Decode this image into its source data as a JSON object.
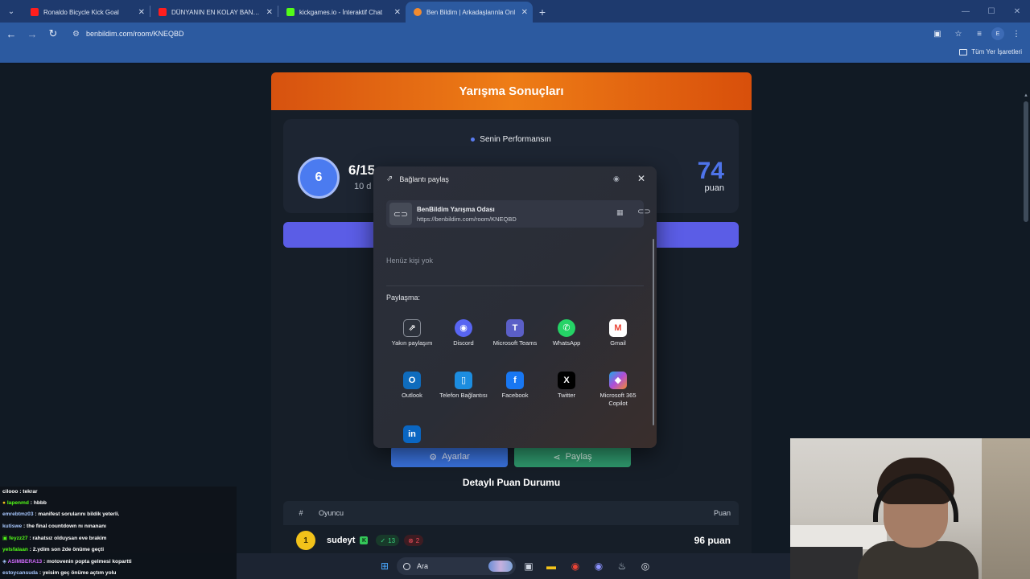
{
  "browser": {
    "tabs": [
      {
        "title": "Ronaldo Bicycle Kick Goal",
        "color": "#ff1e1e",
        "active": false
      },
      {
        "title": "DÜNYANIN EN KOLAY BANKA",
        "color": "#ff1e1e",
        "active": false
      },
      {
        "title": "kickgames.io - İnteraktif Chat",
        "color": "#53fc18",
        "active": false
      },
      {
        "title": "Ben Bildim | Arkadaşlarınla Onl",
        "color": "#f28b30",
        "active": true
      }
    ],
    "url": "benbildim.com/room/KNEQBD",
    "profile_initial": "E",
    "bookmarks_label": "Tüm Yer İşaretleri"
  },
  "results": {
    "header_title": "Yarışma Sonuçları",
    "perf_label": "Senin Performansın",
    "rank": "6",
    "score_fraction": "6/15",
    "score_sub": "10 d",
    "points": "74",
    "points_label": "puan",
    "settings_label": "Ayarlar",
    "share_label": "Paylaş",
    "detail_title": "Detaylı Puan Durumu",
    "table": {
      "col_num": "#",
      "col_player": "Oyuncu",
      "col_points": "Puan",
      "rows": [
        {
          "rank": "1",
          "name": "sudeyt",
          "correct": "13",
          "wrong": "2",
          "points": "96 puan"
        }
      ]
    }
  },
  "share_dialog": {
    "title": "Bağlantı paylaş",
    "link_title": "BenBildim Yarışma Odası",
    "link_url": "https://benbildim.com/room/KNEQBD",
    "no_people": "Henüz kişi yok",
    "share_with": "Paylaşma:",
    "apps": [
      {
        "label": "Yakın paylaşım",
        "icon": "nearby-share-icon",
        "color": "#2d323c"
      },
      {
        "label": "Discord",
        "icon": "discord-icon",
        "color": "#5865f2"
      },
      {
        "label": "Microsoft Teams",
        "icon": "teams-icon",
        "color": "#5b5fc7"
      },
      {
        "label": "WhatsApp",
        "icon": "whatsapp-icon",
        "color": "#25d366"
      },
      {
        "label": "Gmail",
        "icon": "gmail-icon",
        "color": "#ea4335"
      },
      {
        "label": "Outlook",
        "icon": "outlook-icon",
        "color": "#0f6cbd"
      },
      {
        "label": "Telefon Bağlantısı",
        "icon": "phone-link-icon",
        "color": "#1c8de0"
      },
      {
        "label": "Facebook",
        "icon": "facebook-icon",
        "color": "#1877f2"
      },
      {
        "label": "Twitter",
        "icon": "twitter-icon",
        "color": "#000000"
      },
      {
        "label": "Microsoft 365 Copilot",
        "icon": "m365-copilot-icon",
        "color": "#b04ed8"
      },
      {
        "label": "",
        "icon": "linkedin-icon",
        "color": "#0a66c2"
      }
    ]
  },
  "chat": [
    {
      "user": "cilooo",
      "msg": " : tekrar",
      "color": "#ffffff"
    },
    {
      "user": "lapenmd",
      "msg": " : hbbb",
      "color": "#53fc18"
    },
    {
      "user": "emrebtmz03",
      "msg": " : manifest sorularını bildik yeterli.",
      "color": "#a8c8ff"
    },
    {
      "user": "kutiswe",
      "msg": " : the final countdown nı nınananı",
      "color": "#a8c8ff"
    },
    {
      "user": "feyzz27",
      "msg": " : rahatsız olduysan eve brakim",
      "color": "#53fc18"
    },
    {
      "user": "yelsfalaan",
      "msg": " : 2.ydim son 2de önüme geçti",
      "color": "#53fc18"
    },
    {
      "user": "ASIMBERA13",
      "msg": " : motovenin popta gelmesi kopartti",
      "color": "#d36cff"
    },
    {
      "user": "estoycansuda",
      "msg": " : yeisim geç önüme açtım yolu",
      "color": "#a8c8ff"
    }
  ],
  "taskbar": {
    "search_label": "Ara"
  }
}
